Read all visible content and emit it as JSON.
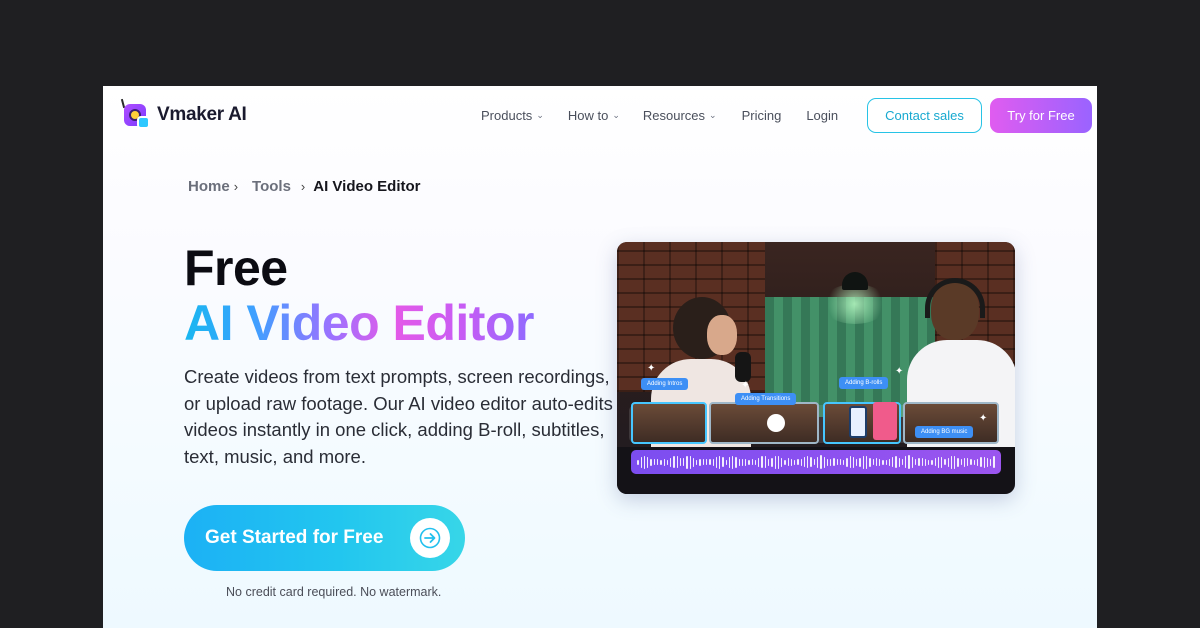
{
  "brand": {
    "name": "Vmaker AI"
  },
  "nav": {
    "items": [
      {
        "label": "Products",
        "dropdown": true
      },
      {
        "label": "How to",
        "dropdown": true
      },
      {
        "label": "Resources",
        "dropdown": true
      },
      {
        "label": "Pricing",
        "dropdown": false
      },
      {
        "label": "Login",
        "dropdown": false
      }
    ],
    "contact_label": "Contact sales",
    "try_label": "Try for Free"
  },
  "breadcrumb": {
    "home": "Home",
    "tools": "Tools",
    "current": "AI Video Editor",
    "separator": "›"
  },
  "hero": {
    "title_line1": "Free",
    "title_line2": "AI Video Editor",
    "description": "Create videos from text prompts, screen recordings, or upload raw footage. Our AI video editor auto-edits videos instantly in one click, adding B-roll, subtitles, text, music, and more.",
    "cta_label": "Get Started for Free",
    "cta_icon": "arrow-right-icon",
    "note": "No credit card required. No watermark."
  },
  "video_preview": {
    "tags": [
      "Adding Intros",
      "Adding Transitions",
      "Adding B-rolls",
      "Adding BG music"
    ]
  },
  "colors": {
    "accent_cyan": "#22c6ef",
    "accent_purple": "#9a63ff",
    "accent_pink": "#e05cf0",
    "page_bg": "#1f1f22"
  }
}
